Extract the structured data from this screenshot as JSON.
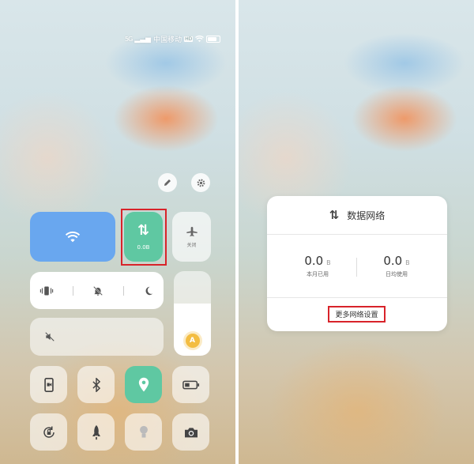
{
  "status_bar": {
    "network_type": "5G",
    "carrier": "中国移动",
    "hd": "HD"
  },
  "control_center": {
    "data_tile": {
      "arrows": "⇅",
      "usage": "0.0B"
    },
    "airplane_tile": {
      "label": "关闭"
    },
    "brightness": {
      "auto_label": "A",
      "level": 0.62
    }
  },
  "data_dialog": {
    "title": "数据网络",
    "stats": [
      {
        "value": "0.0",
        "unit": "B",
        "caption": "本月已用"
      },
      {
        "value": "0.0",
        "unit": "B",
        "caption": "日均使用"
      }
    ],
    "more_settings": "更多网络设置"
  },
  "colors": {
    "wifi_tile": "#69a7ef",
    "active_green": "#5fc8a2",
    "highlight_red": "#d8232a"
  },
  "icons": [
    "pencil-icon",
    "gear-icon",
    "wifi-icon",
    "data-arrows-icon",
    "airplane-icon",
    "vibrate-icon",
    "silent-bell-icon",
    "moon-icon",
    "mute-icon",
    "sun-icon",
    "screen-record-icon",
    "bluetooth-icon",
    "location-icon",
    "battery-icon",
    "rotation-lock-icon",
    "rocket-icon",
    "flashlight-icon",
    "camera-icon"
  ]
}
